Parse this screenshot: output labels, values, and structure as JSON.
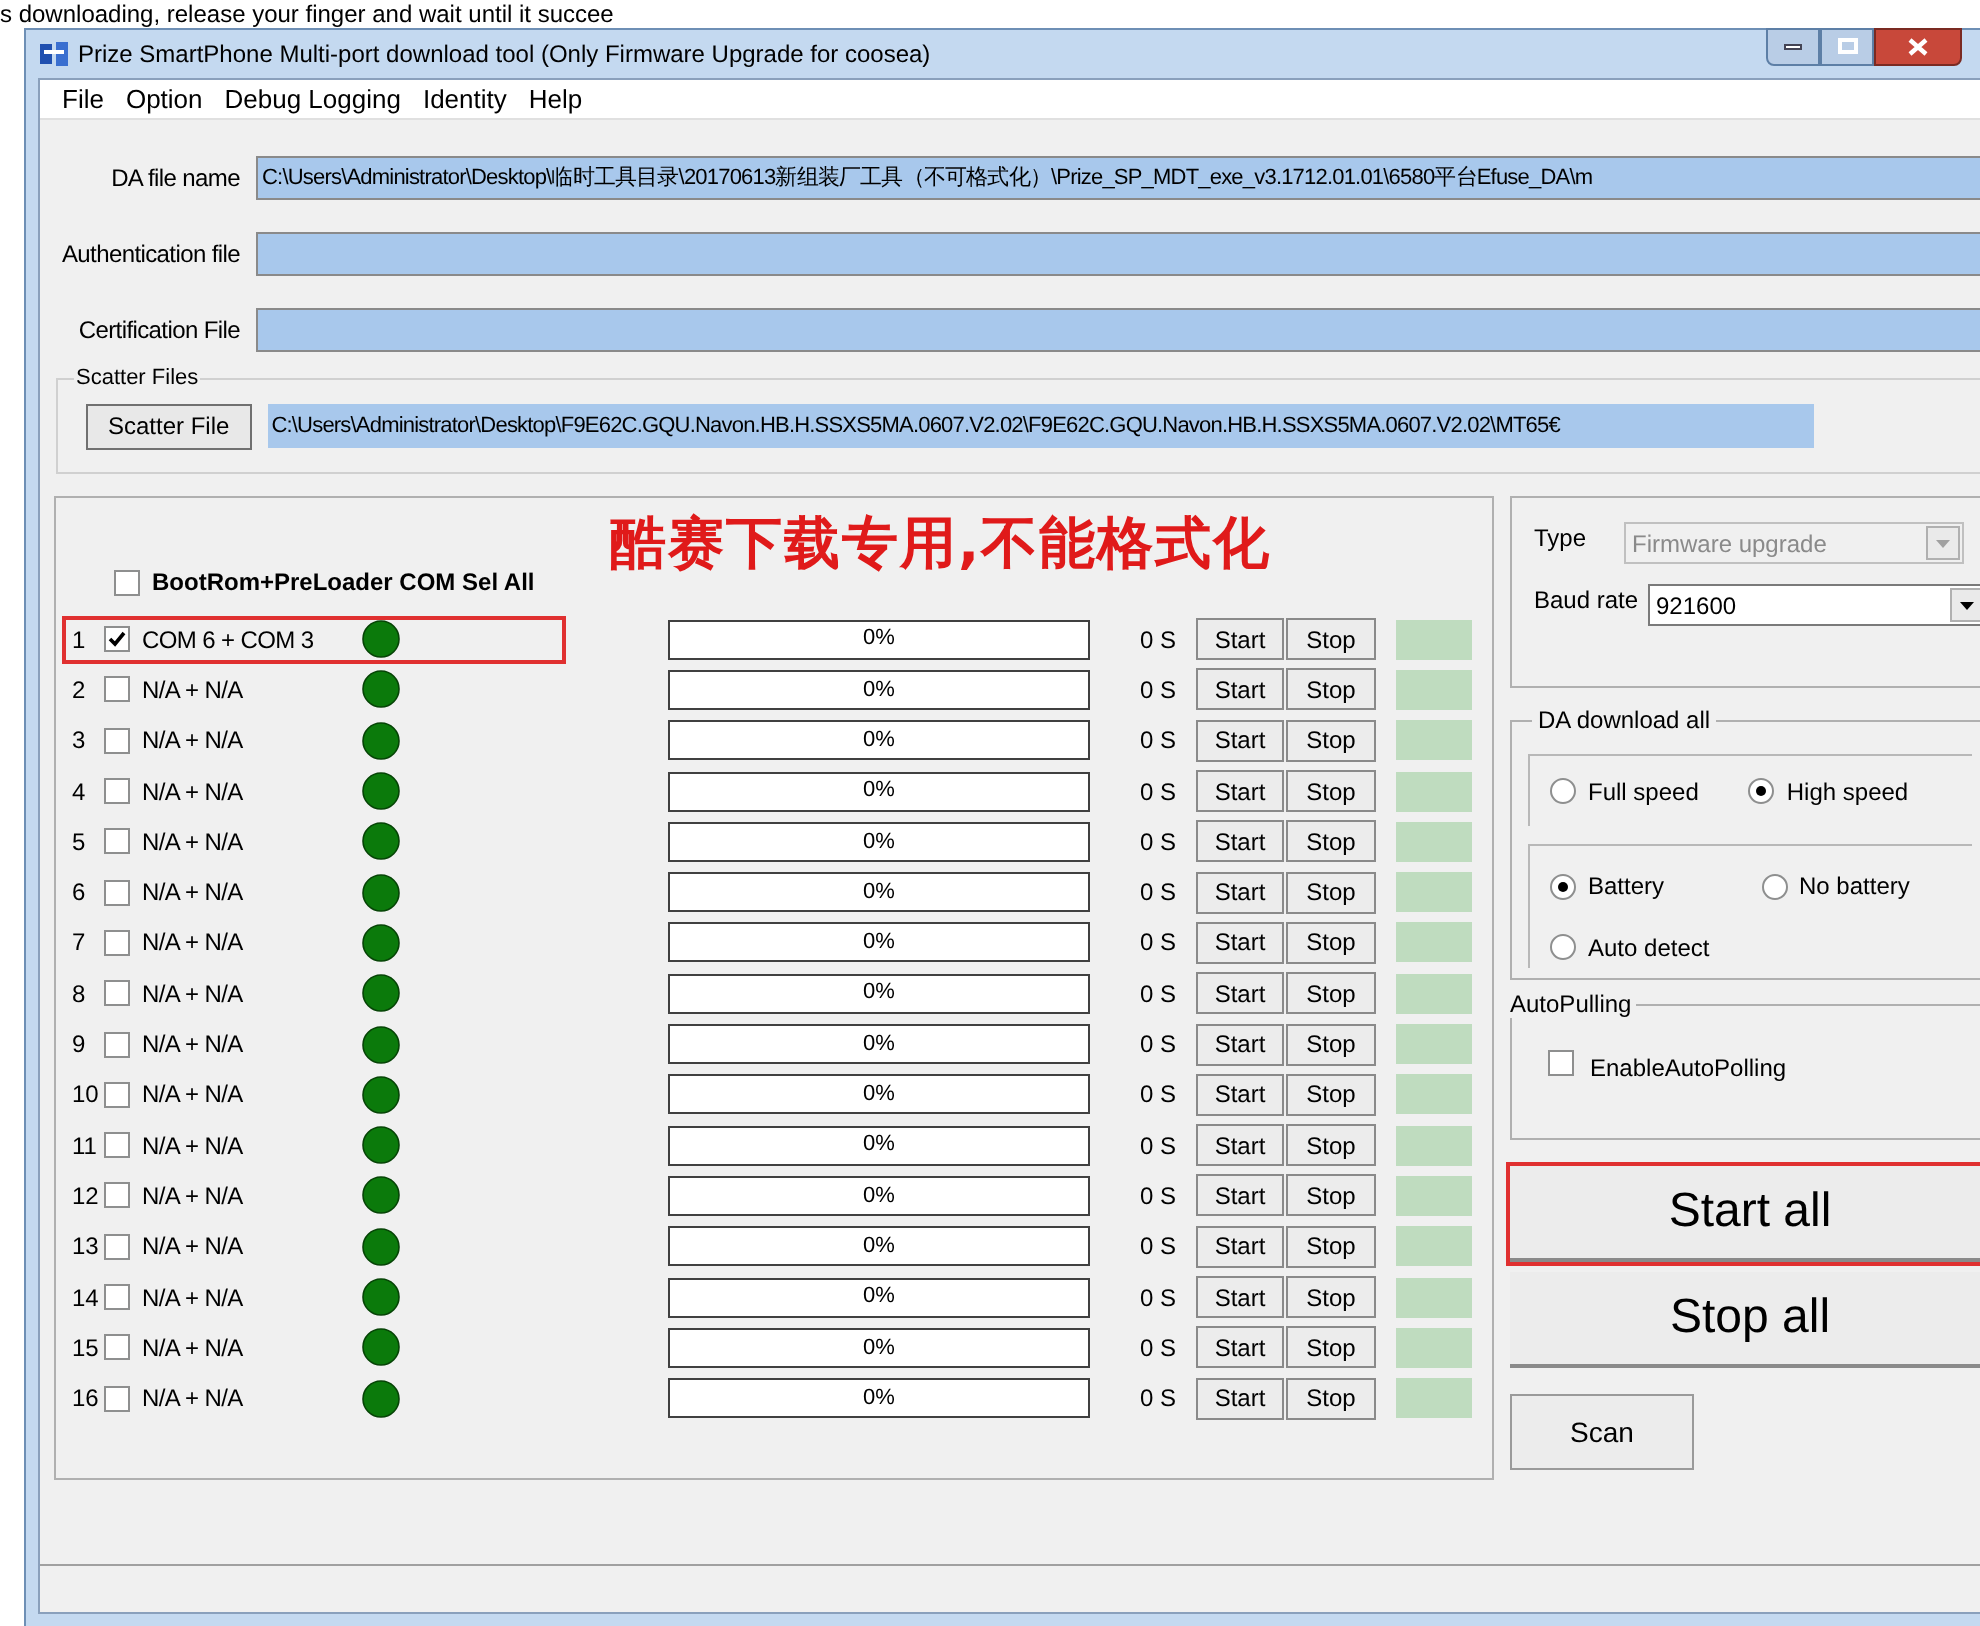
{
  "caption": "s downloading, release your finger and wait until it succee",
  "window": {
    "title": "Prize SmartPhone Multi-port download tool (Only Firmware Upgrade for coosea)"
  },
  "menu": [
    "File",
    "Option",
    "Debug Logging",
    "Identity",
    "Help"
  ],
  "files": [
    {
      "label": "DA file name",
      "value": "C:\\Users\\Administrator\\Desktop\\临时工具目录\\20170613新组装厂工具（不可格式化）\\Prize_SP_MDT_exe_v3.1712.01.01\\6580平台Efuse_DA\\m"
    },
    {
      "label": "Authentication file"
    },
    {
      "label": "Certification File"
    }
  ],
  "scatter": {
    "group_label": "Scatter Files",
    "button": "Scatter File",
    "value": "C:\\Users\\Administrator\\Desktop\\F9E62C.GQU.Navon.HB.H.SSXS5MA.0607.V2.02\\F9E62C.GQU.Navon.HB.H.SSXS5MA.0607.V2.02\\MT65€"
  },
  "annotation": "酷赛下载专用,不能格式化",
  "sel_all": {
    "label": "BootRom+PreLoader COM Sel All",
    "checked": false
  },
  "ports": [
    {
      "index": "1",
      "checked": true,
      "name": "COM 6 + COM 3",
      "highlighted": true,
      "progress": "0%",
      "time": "0 S",
      "start": "Start",
      "stop": "Stop"
    },
    {
      "index": "2",
      "checked": false,
      "name": "N/A + N/A",
      "highlighted": false,
      "progress": "0%",
      "time": "0 S",
      "start": "Start",
      "stop": "Stop"
    },
    {
      "index": "3",
      "checked": false,
      "name": "N/A + N/A",
      "highlighted": false,
      "progress": "0%",
      "time": "0 S",
      "start": "Start",
      "stop": "Stop"
    },
    {
      "index": "4",
      "checked": false,
      "name": "N/A + N/A",
      "highlighted": false,
      "progress": "0%",
      "time": "0 S",
      "start": "Start",
      "stop": "Stop"
    },
    {
      "index": "5",
      "checked": false,
      "name": "N/A + N/A",
      "highlighted": false,
      "progress": "0%",
      "time": "0 S",
      "start": "Start",
      "stop": "Stop"
    },
    {
      "index": "6",
      "checked": false,
      "name": "N/A + N/A",
      "highlighted": false,
      "progress": "0%",
      "time": "0 S",
      "start": "Start",
      "stop": "Stop"
    },
    {
      "index": "7",
      "checked": false,
      "name": "N/A + N/A",
      "highlighted": false,
      "progress": "0%",
      "time": "0 S",
      "start": "Start",
      "stop": "Stop"
    },
    {
      "index": "8",
      "checked": false,
      "name": "N/A + N/A",
      "highlighted": false,
      "progress": "0%",
      "time": "0 S",
      "start": "Start",
      "stop": "Stop"
    },
    {
      "index": "9",
      "checked": false,
      "name": "N/A + N/A",
      "highlighted": false,
      "progress": "0%",
      "time": "0 S",
      "start": "Start",
      "stop": "Stop"
    },
    {
      "index": "10",
      "checked": false,
      "name": "N/A + N/A",
      "highlighted": false,
      "progress": "0%",
      "time": "0 S",
      "start": "Start",
      "stop": "Stop"
    },
    {
      "index": "11",
      "checked": false,
      "name": "N/A + N/A",
      "highlighted": false,
      "progress": "0%",
      "time": "0 S",
      "start": "Start",
      "stop": "Stop"
    },
    {
      "index": "12",
      "checked": false,
      "name": "N/A + N/A",
      "highlighted": false,
      "progress": "0%",
      "time": "0 S",
      "start": "Start",
      "stop": "Stop"
    },
    {
      "index": "13",
      "checked": false,
      "name": "N/A + N/A",
      "highlighted": false,
      "progress": "0%",
      "time": "0 S",
      "start": "Start",
      "stop": "Stop"
    },
    {
      "index": "14",
      "checked": false,
      "name": "N/A + N/A",
      "highlighted": false,
      "progress": "0%",
      "time": "0 S",
      "start": "Start",
      "stop": "Stop"
    },
    {
      "index": "15",
      "checked": false,
      "name": "N/A + N/A",
      "highlighted": false,
      "progress": "0%",
      "time": "0 S",
      "start": "Start",
      "stop": "Stop"
    },
    {
      "index": "16",
      "checked": false,
      "name": "N/A + N/A",
      "highlighted": false,
      "progress": "0%",
      "time": "0 S",
      "start": "Start",
      "stop": "Stop"
    }
  ],
  "settings": {
    "type_label": "Type",
    "type_value": "Firmware upgrade",
    "type_disabled": true,
    "baud_label": "Baud rate",
    "baud_value": "921600"
  },
  "da_download": {
    "title": "DA download all",
    "speed": [
      {
        "label": "Full speed",
        "selected": false
      },
      {
        "label": "High speed",
        "selected": true
      }
    ],
    "battery": [
      {
        "label": "Battery",
        "selected": true
      },
      {
        "label": "No battery",
        "selected": false
      },
      {
        "label": "Auto detect",
        "selected": false
      }
    ]
  },
  "auto_pulling": {
    "title": "AutoPulling",
    "label": "EnableAutoPolling",
    "checked": false
  },
  "actions": [
    {
      "label": "Start all",
      "highlighted": true
    },
    {
      "label": "Stop all",
      "highlighted": false
    }
  ],
  "scan": "Scan"
}
